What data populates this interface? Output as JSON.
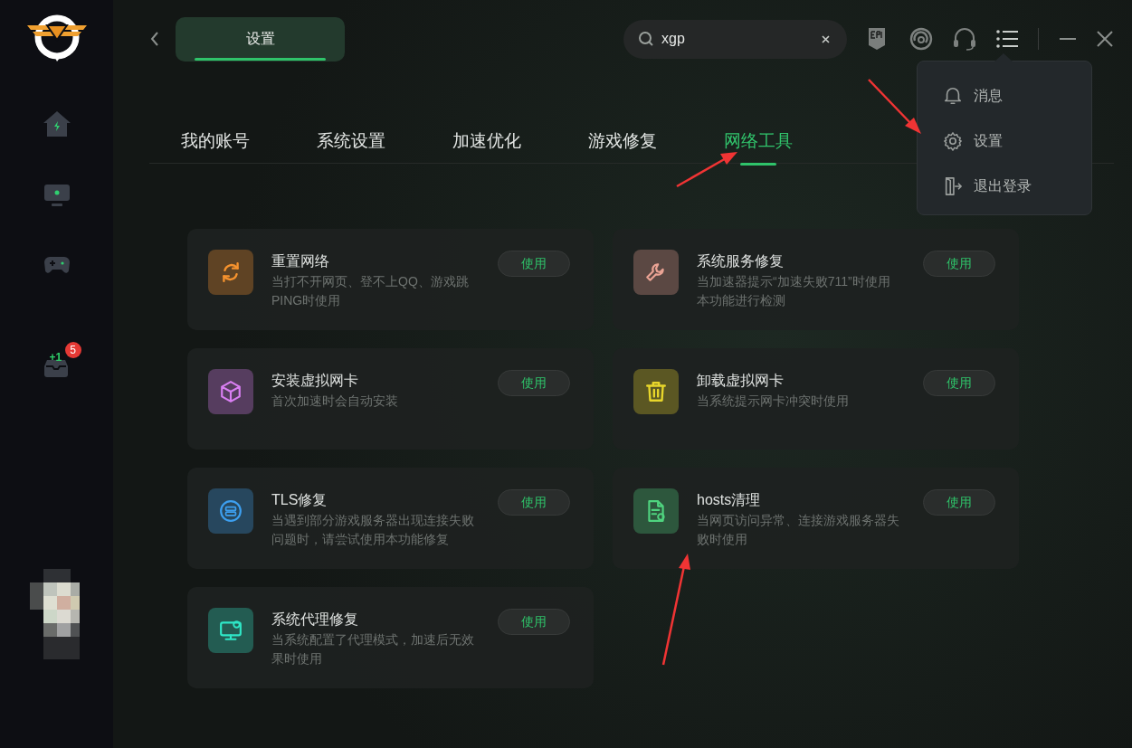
{
  "sidebar": {
    "inbox_label": "+1",
    "badge": "5"
  },
  "header": {
    "page_tab": {
      "label": "设置",
      "selected": true
    },
    "search": {
      "value": "xgp"
    }
  },
  "tabs": [
    {
      "label": "我的账号",
      "selected": false
    },
    {
      "label": "系统设置",
      "selected": false
    },
    {
      "label": "加速优化",
      "selected": false
    },
    {
      "label": "游戏修复",
      "selected": false
    },
    {
      "label": "网络工具",
      "selected": true
    }
  ],
  "tools": [
    {
      "kind": "refresh",
      "color": "#f5922e",
      "title": "重置网络",
      "description": "当打不开网页、登不上QQ、游戏跳PING时使用",
      "button": "使用"
    },
    {
      "kind": "wrench",
      "color": "#eaa394",
      "title": "系统服务修复",
      "description": "当加速器提示“加速失败711”时使用本功能进行检测",
      "button": "使用"
    },
    {
      "kind": "cube",
      "color": "#d97ff2",
      "title": "安装虚拟网卡",
      "description": "首次加速时会自动安装",
      "button": "使用"
    },
    {
      "kind": "trash",
      "color": "#e8d62b",
      "title": "卸载虚拟网卡",
      "description": "当系统提示网卡冲突时使用",
      "button": "使用"
    },
    {
      "kind": "server",
      "color": "#3d9ff0",
      "title": "TLS修复",
      "description": "当遇到部分游戏服务器出现连接失败问题时，请尝试使用本功能修复",
      "button": "使用"
    },
    {
      "kind": "document",
      "color": "#4fd47f",
      "title": "hosts清理",
      "description": "当网页访问异常、连接游戏服务器失败时使用",
      "button": "使用"
    },
    {
      "kind": "monitor",
      "color": "#2fe6c6",
      "title": "系统代理修复",
      "description": "当系统配置了代理模式，加速后无效果时使用",
      "button": "使用"
    }
  ],
  "menu": {
    "items": [
      {
        "kind": "bell",
        "label": "消息"
      },
      {
        "kind": "gear",
        "label": "设置"
      },
      {
        "kind": "exit",
        "label": "退出登录"
      }
    ]
  }
}
